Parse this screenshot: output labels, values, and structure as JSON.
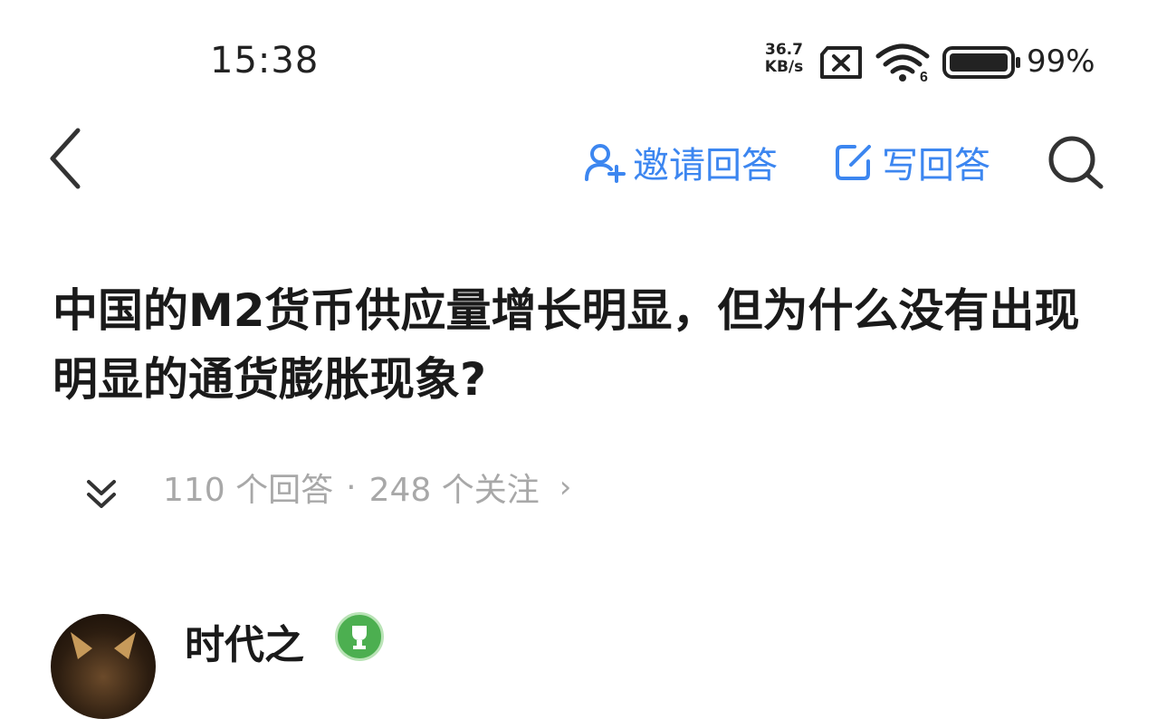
{
  "status_bar": {
    "time": "15:38",
    "net_speed_value": "36.7",
    "net_speed_unit": "KB/s",
    "wifi_label": "6",
    "battery": "99%"
  },
  "nav": {
    "invite_label": "邀请回答",
    "write_label": "写回答"
  },
  "question": {
    "title": "中国的M2货币供应量增长明显，但为什么没有出现明显的通货膨胀现象?",
    "answers": "110 个回答",
    "separator": "·",
    "follows": "248 个关注",
    "meta_chevron": "›"
  },
  "answer": {
    "author": "时代之"
  },
  "colors": {
    "accent": "#3c86f0",
    "muted": "#a8a8a8",
    "text": "#1a1a1a"
  }
}
